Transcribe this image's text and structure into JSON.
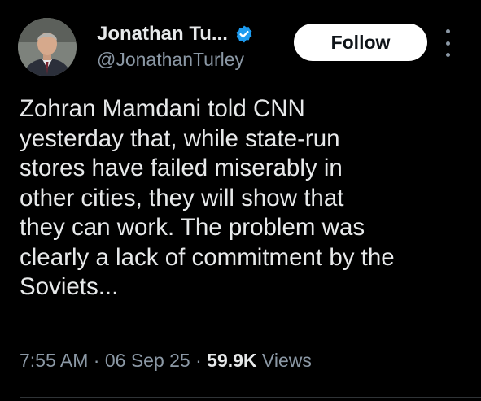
{
  "author": {
    "display_name": "Jonathan Tu...",
    "handle": "@JonathanTurley",
    "verified_icon": "verified-badge-icon",
    "avatar_icon": "profile-photo"
  },
  "actions": {
    "follow_label": "Follow",
    "more_icon": "more-vertical-icon"
  },
  "tweet": {
    "lines": [
      "Zohran Mamdani told CNN",
      "yesterday that, while state-run",
      "stores have failed miserably in",
      "other cities, they will show that",
      "they can work. The problem was",
      "clearly a lack of commitment by the",
      "Soviets..."
    ]
  },
  "meta": {
    "time": "7:55 AM",
    "separator": " · ",
    "date": "06 Sep 25",
    "views_count": "59.9K",
    "views_label": " Views"
  },
  "colors": {
    "background": "#000000",
    "text_primary": "#e7e9ea",
    "text_secondary": "#8b98a5",
    "verified": "#1d9bf0",
    "follow_bg": "#ffffff",
    "divider": "#2f3336"
  }
}
